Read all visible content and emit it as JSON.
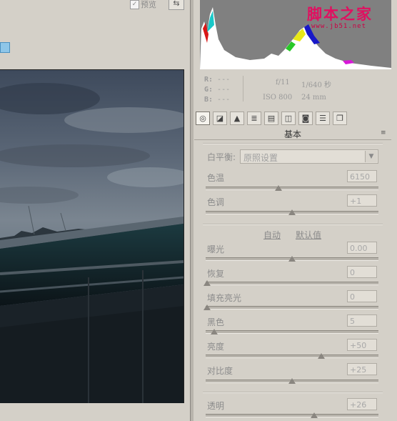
{
  "preview": {
    "checkbox_mark": "✓",
    "label": "预览",
    "swap_icon": "⇆"
  },
  "rgb": [
    {
      "label": "R:",
      "value": "---"
    },
    {
      "label": "G:",
      "value": "---"
    },
    {
      "label": "B:",
      "value": "---"
    }
  ],
  "meta": {
    "aperture": "f/11",
    "shutter": "1/640 秒",
    "iso": "ISO 800",
    "focal": "24 mm"
  },
  "tabs": [
    {
      "name": "basic",
      "icon": "aperture-icon"
    },
    {
      "name": "tone-curve",
      "icon": "curve-icon"
    },
    {
      "name": "detail",
      "icon": "mountain-icon"
    },
    {
      "name": "hsl",
      "icon": "bars-icon"
    },
    {
      "name": "split-toning",
      "icon": "split-icon"
    },
    {
      "name": "lens",
      "icon": "lens-icon"
    },
    {
      "name": "camera",
      "icon": "camera-icon"
    },
    {
      "name": "presets",
      "icon": "sliders-icon"
    },
    {
      "name": "snapshots",
      "icon": "pages-icon"
    }
  ],
  "panel": {
    "title": "基本",
    "menu_icon": "≡"
  },
  "white_balance": {
    "label": "白平衡:",
    "value": "原照设置"
  },
  "auto_label": "自动",
  "default_label": "默认值",
  "sliders": [
    {
      "label": "色温",
      "value": "6150",
      "position": 0.42
    },
    {
      "label": "色调",
      "value": "+1",
      "position": 0.5
    },
    {
      "label": "曝光",
      "value": "0.00",
      "position": 0.5
    },
    {
      "label": "恢复",
      "value": "0",
      "position": 0.0
    },
    {
      "label": "填充亮光",
      "value": "0",
      "position": 0.0
    },
    {
      "label": "黑色",
      "value": "5",
      "position": 0.05
    },
    {
      "label": "亮度",
      "value": "+50",
      "position": 0.67
    },
    {
      "label": "对比度",
      "value": "+25",
      "position": 0.5
    },
    {
      "label": "透明",
      "value": "+26",
      "position": 0.63
    }
  ],
  "watermark": {
    "title": "脚本之家",
    "url": "www.jb51.net"
  },
  "colors": {
    "panel_bg": "#d4d0c8",
    "histogram_bg": "#808080",
    "accent": "#8ec6e8"
  }
}
